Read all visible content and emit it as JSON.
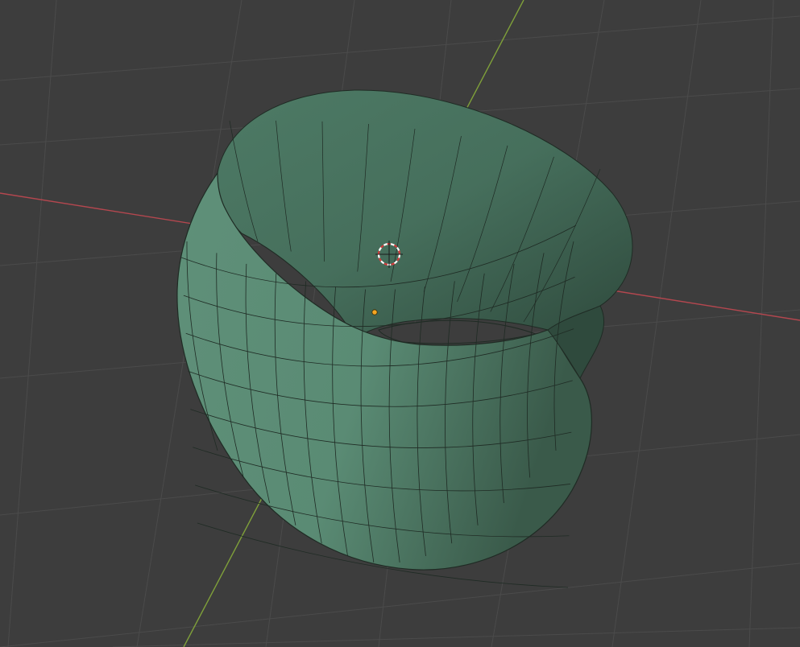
{
  "app": "3D viewport",
  "viewport": {
    "background_color": "#3d3d3d",
    "grid_color": "#4b4b4b",
    "x_axis_color": "#b4474f",
    "y_axis_color": "#7fa03a",
    "mesh": {
      "shape": "twisted ring surface",
      "shading": "solid",
      "face_color": "#5d8f77",
      "wire_color": "#1f2b24",
      "selected": false
    },
    "cursor_3d_icon": "crosshair-circle-icon",
    "origin_icon": "object-origin-dot-icon",
    "origin_color": "#f5a623"
  }
}
